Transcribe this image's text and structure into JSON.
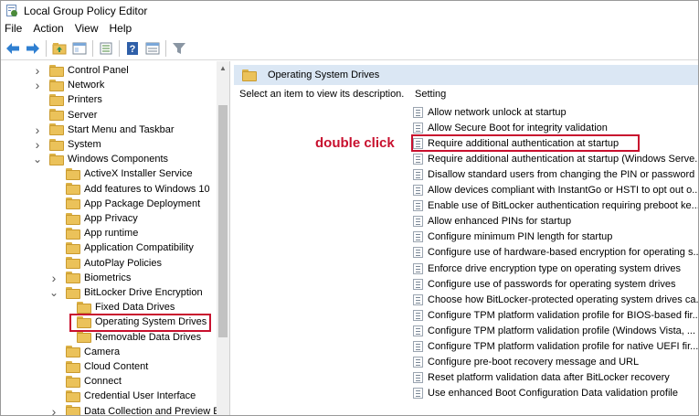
{
  "window": {
    "title": "Local Group Policy Editor"
  },
  "menu": {
    "items": [
      "File",
      "Action",
      "View",
      "Help"
    ]
  },
  "toolbar": {
    "buttons": [
      "back-icon",
      "forward-icon",
      "up-folder-icon",
      "show-hide-tree-icon",
      "export-list-icon",
      "help-icon",
      "properties-icon",
      "filter-icon"
    ]
  },
  "tree": {
    "items": [
      {
        "label": "Control Panel",
        "expander": "collapsed",
        "level": 1
      },
      {
        "label": "Network",
        "expander": "collapsed",
        "level": 1
      },
      {
        "label": "Printers",
        "expander": "none",
        "level": 1
      },
      {
        "label": "Server",
        "expander": "none",
        "level": 1
      },
      {
        "label": "Start Menu and Taskbar",
        "expander": "collapsed",
        "level": 1
      },
      {
        "label": "System",
        "expander": "collapsed",
        "level": 1
      },
      {
        "label": "Windows Components",
        "expander": "expanded",
        "level": 1
      },
      {
        "label": "ActiveX Installer Service",
        "expander": "none",
        "level": 2
      },
      {
        "label": "Add features to Windows 10",
        "expander": "none",
        "level": 2
      },
      {
        "label": "App Package Deployment",
        "expander": "none",
        "level": 2
      },
      {
        "label": "App Privacy",
        "expander": "none",
        "level": 2
      },
      {
        "label": "App runtime",
        "expander": "none",
        "level": 2
      },
      {
        "label": "Application Compatibility",
        "expander": "none",
        "level": 2
      },
      {
        "label": "AutoPlay Policies",
        "expander": "none",
        "level": 2
      },
      {
        "label": "Biometrics",
        "expander": "collapsed",
        "level": 2
      },
      {
        "label": "BitLocker Drive Encryption",
        "expander": "expanded",
        "level": 2
      },
      {
        "label": "Fixed Data Drives",
        "expander": "none",
        "level": 3
      },
      {
        "label": "Operating System Drives",
        "expander": "none",
        "level": 3,
        "highlighted": true
      },
      {
        "label": "Removable Data Drives",
        "expander": "none",
        "level": 3
      },
      {
        "label": "Camera",
        "expander": "none",
        "level": 2
      },
      {
        "label": "Cloud Content",
        "expander": "none",
        "level": 2
      },
      {
        "label": "Connect",
        "expander": "none",
        "level": 2
      },
      {
        "label": "Credential User Interface",
        "expander": "none",
        "level": 2
      },
      {
        "label": "Data Collection and Preview Bui",
        "expander": "collapsed",
        "level": 2
      }
    ]
  },
  "main": {
    "header": "Operating System Drives",
    "description": "Select an item to view its description.",
    "column_header": "Setting",
    "annotation": "double click",
    "highlight_color": "#c8102e",
    "settings": [
      "Allow network unlock at startup",
      "Allow Secure Boot for integrity validation",
      "Require additional authentication at startup",
      "Require additional authentication at startup (Windows Serve...",
      "Disallow standard users from changing the PIN or password",
      "Allow devices compliant with InstantGo or HSTI to opt out o...",
      "Enable use of BitLocker authentication requiring preboot ke...",
      "Allow enhanced PINs for startup",
      "Configure minimum PIN length for startup",
      "Configure use of hardware-based encryption for operating s...",
      "Enforce drive encryption type on operating system drives",
      "Configure use of passwords for operating system drives",
      "Choose how BitLocker-protected operating system drives ca...",
      "Configure TPM platform validation profile for BIOS-based fir...",
      "Configure TPM platform validation profile (Windows Vista, ...",
      "Configure TPM platform validation profile for native UEFI fir...",
      "Configure pre-boot recovery message and URL",
      "Reset platform validation data after BitLocker recovery",
      "Use enhanced Boot Configuration Data validation profile"
    ],
    "highlighted_setting_index": 2
  }
}
